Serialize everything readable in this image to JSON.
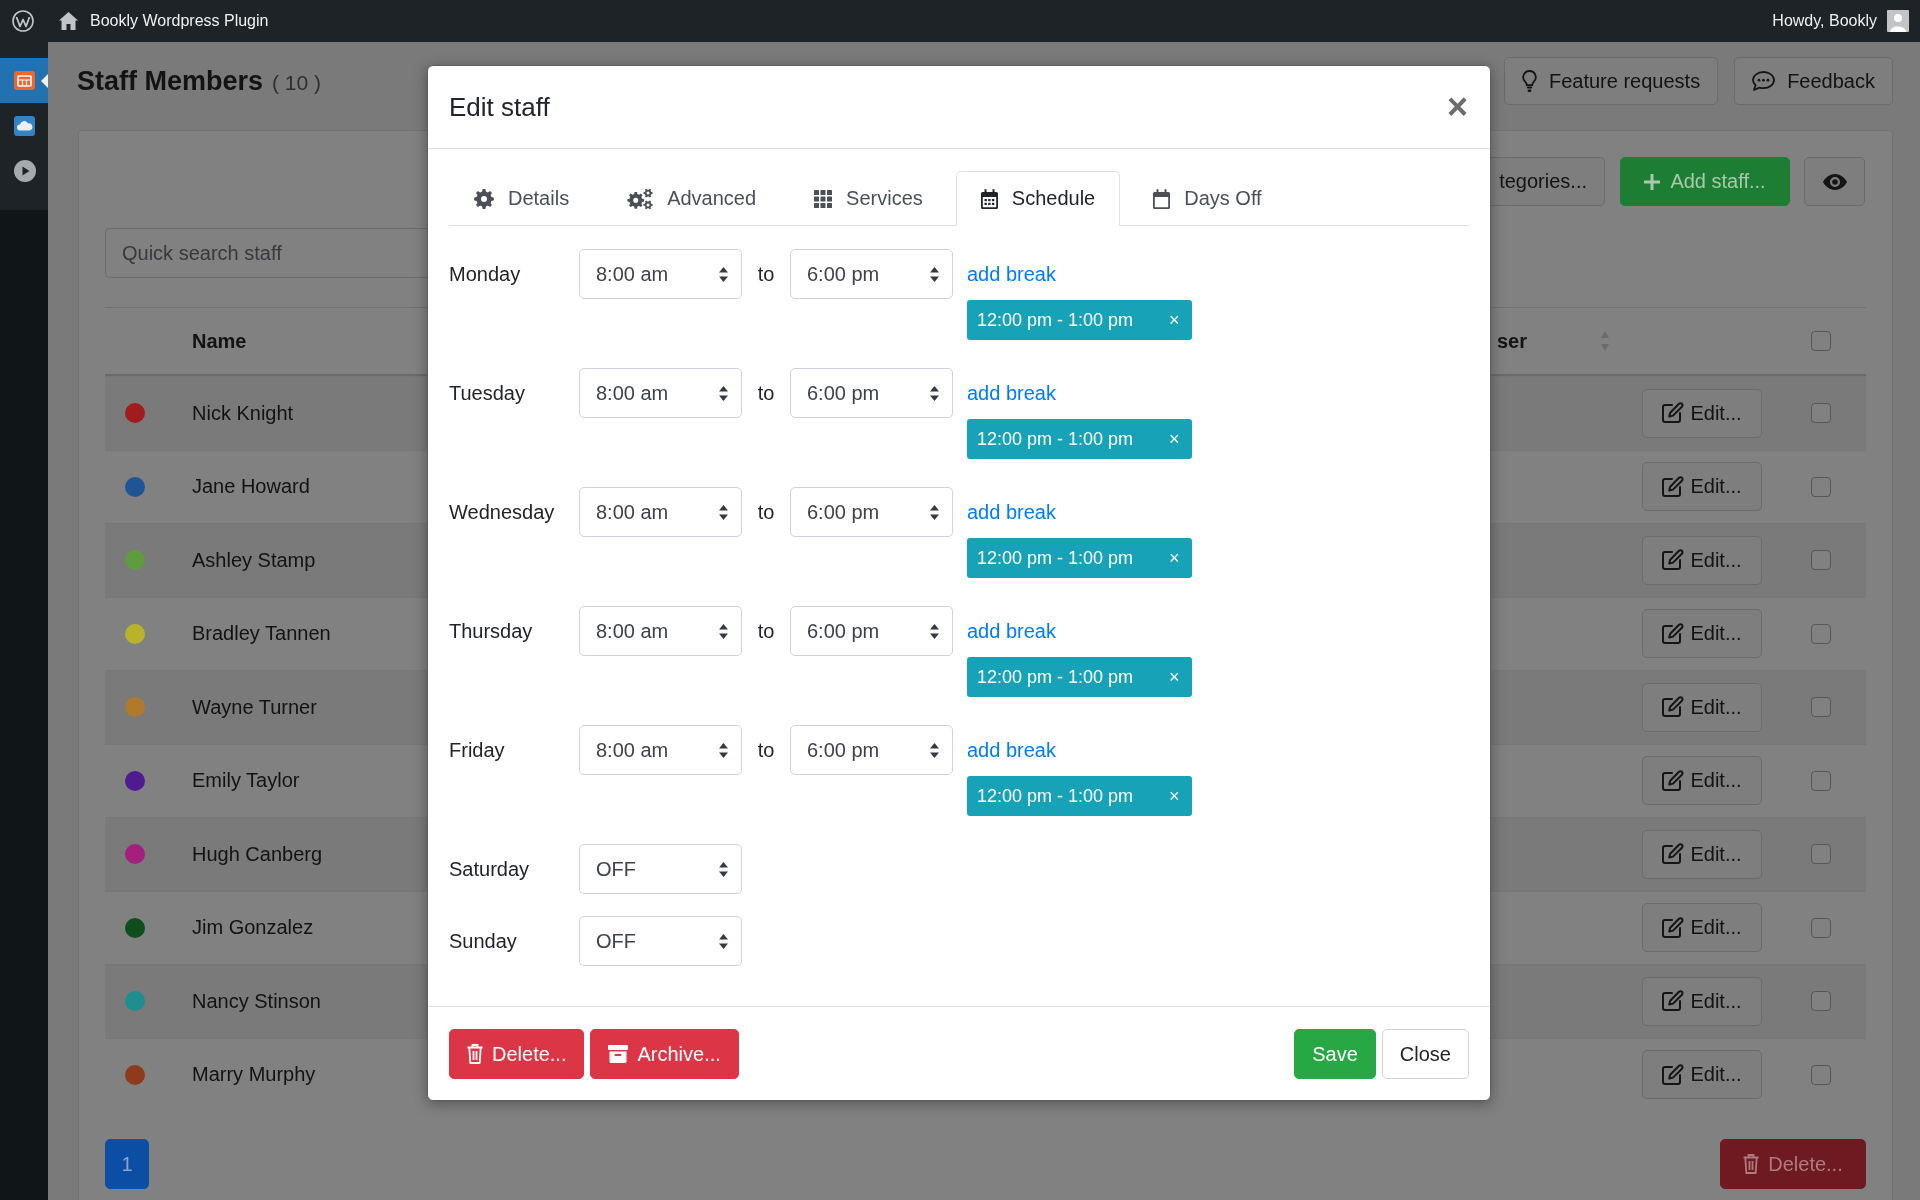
{
  "admin_bar": {
    "site_name": "Bookly Wordpress Plugin",
    "greeting": "Howdy, Bookly"
  },
  "sidebar": {
    "items": [
      {
        "selected": true
      },
      {
        "selected": false
      },
      {
        "selected": false
      }
    ]
  },
  "page": {
    "title": "Staff Members",
    "count": "( 10 )",
    "buttons": [
      {
        "kind": "feature_requests",
        "label": "Feature requests"
      },
      {
        "kind": "feedback",
        "label": "Feedback"
      }
    ]
  },
  "toolbar": {
    "buttons": [
      {
        "kind": "categories",
        "label": "tegories..."
      },
      {
        "kind": "add",
        "label": "Add staff..."
      },
      {
        "kind": "view"
      }
    ]
  },
  "search": {
    "placeholder": "Quick search staff"
  },
  "table": {
    "columns": [
      {
        "label": "Name",
        "sortable": false
      },
      {
        "label": "ser",
        "sortable": true
      }
    ],
    "select_all": {
      "checked": false
    },
    "rows": [
      {
        "name": "Nick Knight",
        "color": "#a01c1e",
        "edit_label": "Edit...",
        "checked": false
      },
      {
        "name": "Jane Howard",
        "color": "#1f5596",
        "edit_label": "Edit...",
        "checked": false
      },
      {
        "name": "Ashley Stamp",
        "color": "#5f9c3d",
        "edit_label": "Edit...",
        "checked": false
      },
      {
        "name": "Bradley Tannen",
        "color": "#b8b32a",
        "edit_label": "Edit...",
        "checked": false
      },
      {
        "name": "Wayne Turner",
        "color": "#b07a2c",
        "edit_label": "Edit...",
        "checked": false
      },
      {
        "name": "Emily Taylor",
        "color": "#501a90",
        "edit_label": "Edit...",
        "checked": false
      },
      {
        "name": "Hugh Canberg",
        "color": "#a3207f",
        "edit_label": "Edit...",
        "checked": false
      },
      {
        "name": "Jim Gonzalez",
        "color": "#0e4d1c",
        "edit_label": "Edit...",
        "checked": false
      },
      {
        "name": "Nancy Stinson",
        "color": "#208d8f",
        "edit_label": "Edit...",
        "checked": false
      },
      {
        "name": "Marry Murphy",
        "color": "#8e3b1d",
        "edit_label": "Edit...",
        "checked": false
      }
    ]
  },
  "pagination": {
    "pages": [
      {
        "label": "1",
        "selected": true
      }
    ]
  },
  "bulk_delete": {
    "label": "Delete..."
  },
  "modal": {
    "title": "Edit staff",
    "close": "×",
    "tabs": [
      {
        "kind": "details",
        "label": "Details",
        "selected": false
      },
      {
        "kind": "advanced",
        "label": "Advanced",
        "selected": false
      },
      {
        "kind": "services",
        "label": "Services",
        "selected": false
      },
      {
        "kind": "schedule",
        "label": "Schedule",
        "selected": true
      },
      {
        "kind": "days_off",
        "label": "Days Off",
        "selected": false
      }
    ],
    "schedule": [
      {
        "day": "Monday",
        "start": "8:00 am",
        "separator": "to",
        "end": "6:00 pm",
        "add_break": "add break",
        "breaks": [
          {
            "range": "12:00 pm - 1:00 pm",
            "remove": "×"
          }
        ]
      },
      {
        "day": "Tuesday",
        "start": "8:00 am",
        "separator": "to",
        "end": "6:00 pm",
        "add_break": "add break",
        "breaks": [
          {
            "range": "12:00 pm - 1:00 pm",
            "remove": "×"
          }
        ]
      },
      {
        "day": "Wednesday",
        "start": "8:00 am",
        "separator": "to",
        "end": "6:00 pm",
        "add_break": "add break",
        "breaks": [
          {
            "range": "12:00 pm - 1:00 pm",
            "remove": "×"
          }
        ]
      },
      {
        "day": "Thursday",
        "start": "8:00 am",
        "separator": "to",
        "end": "6:00 pm",
        "add_break": "add break",
        "breaks": [
          {
            "range": "12:00 pm - 1:00 pm",
            "remove": "×"
          }
        ]
      },
      {
        "day": "Friday",
        "start": "8:00 am",
        "separator": "to",
        "end": "6:00 pm",
        "add_break": "add break",
        "breaks": [
          {
            "range": "12:00 pm - 1:00 pm",
            "remove": "×"
          }
        ]
      },
      {
        "day": "Saturday",
        "start": "OFF"
      },
      {
        "day": "Sunday",
        "start": "OFF"
      }
    ],
    "footer": [
      {
        "kind": "delete",
        "label": "Delete..."
      },
      {
        "kind": "archive",
        "label": "Archive..."
      },
      {
        "kind": "save",
        "label": "Save"
      },
      {
        "kind": "close",
        "label": "Close"
      }
    ]
  }
}
